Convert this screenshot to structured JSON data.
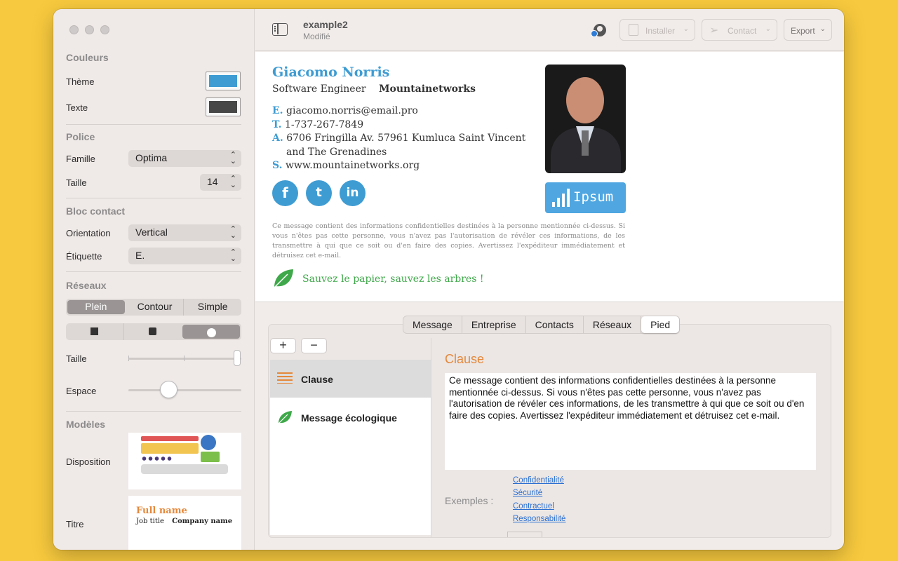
{
  "window": {
    "document_title": "example2",
    "document_status": "Modifié"
  },
  "toolbar": {
    "install_label": "Installer",
    "contact_label": "Contact",
    "export_label": "Export"
  },
  "sidebar": {
    "colors": {
      "title": "Couleurs",
      "theme_label": "Thème",
      "theme_color": "#3E9CD3",
      "text_label": "Texte",
      "text_color": "#474747"
    },
    "font": {
      "title": "Police",
      "family_label": "Famille",
      "family_value": "Optima",
      "size_label": "Taille",
      "size_value": "14"
    },
    "contact_block": {
      "title": "Bloc contact",
      "orientation_label": "Orientation",
      "orientation_value": "Vertical",
      "label_label": "Étiquette",
      "label_value": "E."
    },
    "networks": {
      "title": "Réseaux",
      "styles": [
        "Plein",
        "Contour",
        "Simple"
      ],
      "selected_style": "Plein",
      "shape_selected_index": 2,
      "size_label": "Taille",
      "size_level": 1.0,
      "spacing_label": "Espace",
      "spacing_level": 0.35
    },
    "models": {
      "title": "Modèles",
      "layout_label": "Disposition",
      "title_label": "Titre",
      "title_preview_name": "Full name",
      "title_preview_job": "Job title",
      "title_preview_company": "Company name"
    }
  },
  "signature": {
    "name": "Giacomo Norris",
    "job_title": "Software Engineer",
    "company": "Mountainetworks",
    "email_label": "E.",
    "email": "giacomo.norris@email.pro",
    "phone_label": "T.",
    "phone": "1-737-267-7849",
    "address_label": "A.",
    "address_line1": "6706 Fringilla Av. 57961 Kumluca Saint Vincent",
    "address_line2": "and The Grenadines",
    "site_label": "S.",
    "site": "www.mountainetworks.org",
    "social": [
      "f",
      "t",
      "in"
    ],
    "logo_text": "Ipsum",
    "disclaimer": "Ce message contient des informations confidentielles destinées à la personne mentionnée ci-dessus. Si vous n'êtes pas cette personne, vous n'avez pas l'autorisation de révéler ces informations, de les transmettre à qui que ce soit ou d'en faire des copies. Avertissez l'expéditeur immédiatement et détruisez cet e-mail.",
    "eco_message": "Sauvez le papier, sauvez les arbres !"
  },
  "tabs": [
    "Message",
    "Entreprise",
    "Contacts",
    "Réseaux",
    "Pied"
  ],
  "active_tab": "Pied",
  "footer_editor": {
    "add_label": "+",
    "remove_label": "−",
    "items": [
      "Clause",
      "Message écologique"
    ],
    "selected_item": "Clause",
    "clause_title": "Clause",
    "clause_text": "Ce message contient des informations confidentielles destinées à la personne mentionnée ci-dessus. Si vous n'êtes pas cette personne, vous n'avez pas l'autorisation de révéler ces informations, de les transmettre à qui que ce soit ou d'en faire des copies. Avertissez l'expéditeur immédiatement et détruisez cet e-mail.",
    "examples_label": "Exemples :",
    "examples": [
      "Confidentialité",
      "Sécurité",
      "Contractuel",
      "Responsabilité"
    ]
  }
}
